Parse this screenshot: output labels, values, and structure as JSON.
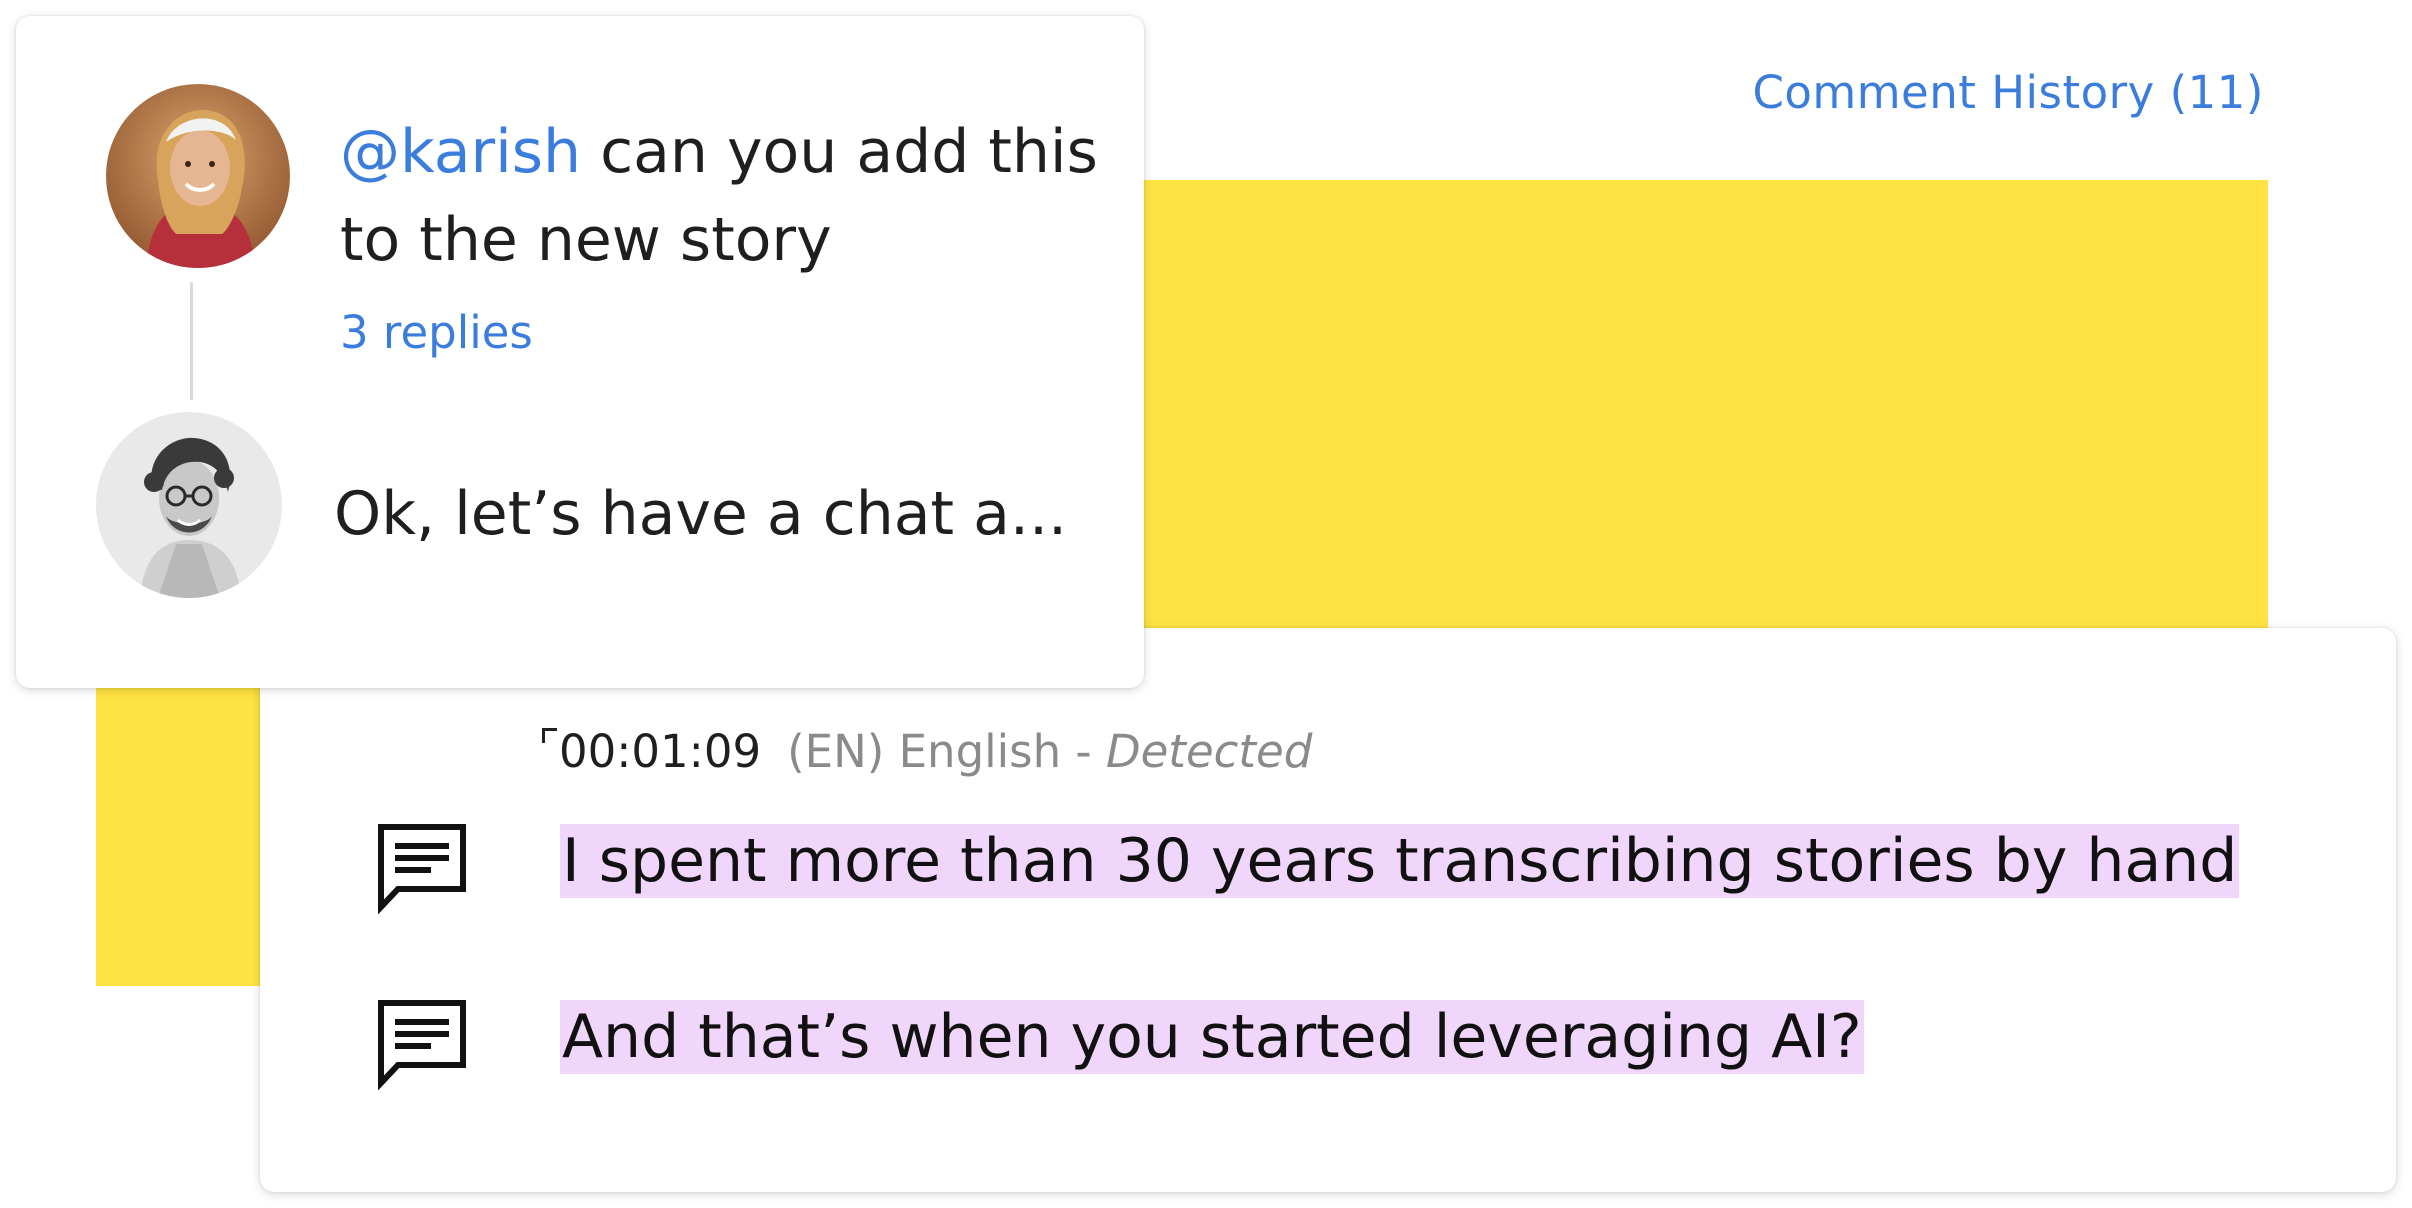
{
  "header": {
    "comment_history_label": "Comment History (11)"
  },
  "comment_thread": {
    "comment": {
      "mention": "@karish",
      "text": " can you add this to the new story",
      "replies_label": "3 replies"
    },
    "reply": {
      "text": "Ok, let’s have a chat a..."
    }
  },
  "transcript": {
    "timecode": "00:01:09",
    "language": "(EN) English - ",
    "language_status": "Detected",
    "lines": [
      {
        "text": "I spent more than 30 years transcribing stories by hand"
      },
      {
        "text": "And that’s when you started leveraging AI?"
      }
    ]
  },
  "colors": {
    "accent": "#3B7DDD",
    "panel_yellow": "#FFE342",
    "highlight": "#F0D6FA",
    "text_dark": "#1F1F1F",
    "text_muted": "#8A8A8A"
  },
  "icons": {
    "comment_icon": "comment-icon",
    "timecode_marker": "timecode-marker-icon"
  }
}
